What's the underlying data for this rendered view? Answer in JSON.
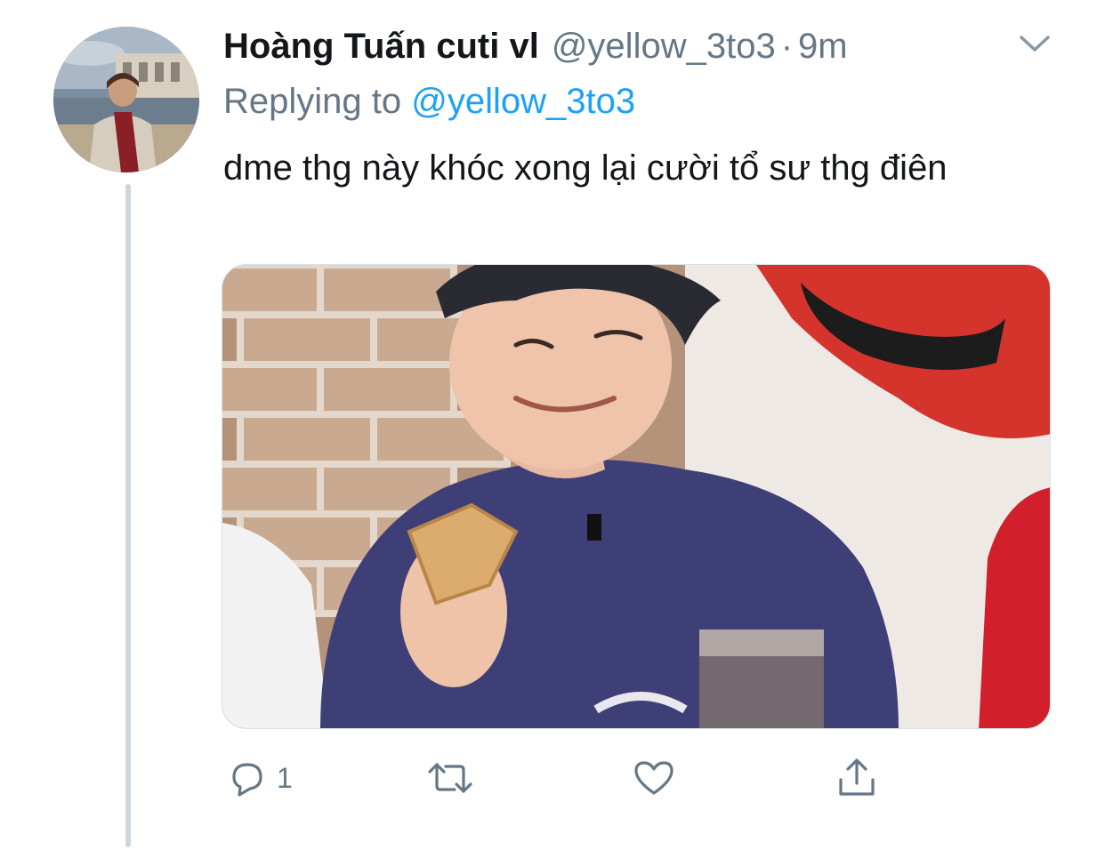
{
  "tweet": {
    "display_name": "Hoàng Tuấn cuti vl",
    "handle": "@yellow_3to3",
    "separator": "·",
    "time": "9m",
    "replying_prefix": "Replying to",
    "replying_to": "@yellow_3to3",
    "text": "dme thg này khóc xong lại cười tổ sư thg điên",
    "media_description": "",
    "reply_count": "1",
    "retweet_count": "",
    "like_count": ""
  },
  "icons": {
    "more": "chevron-down-icon",
    "reply": "reply-icon",
    "retweet": "retweet-icon",
    "like": "heart-icon",
    "share": "share-icon"
  },
  "colors": {
    "text": "#14171a",
    "secondary": "#657786",
    "accent": "#1da1f2",
    "thread_line": "#cdd6dd"
  }
}
